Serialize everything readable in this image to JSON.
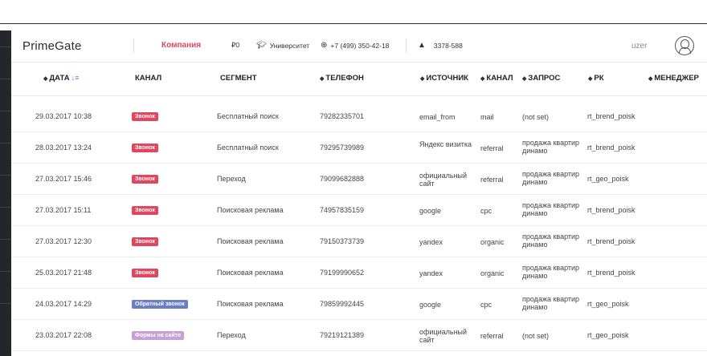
{
  "header": {
    "logo": "PrimeGate",
    "company": "Компания",
    "balance": "₽0",
    "university": "Университет",
    "phone": "+7 (499) 350-42-18",
    "account_id": "3378-588",
    "user": "uzer"
  },
  "columns": {
    "date": "ДАТА",
    "channel": "КАНАЛ",
    "segment": "СЕГМЕНТ",
    "phone": "ТЕЛЕФОН",
    "source": "ИСТОЧНИК",
    "medium": "КАНАЛ",
    "query": "ЗАПРОС",
    "campaign": "РК",
    "manager": "МЕНЕДЖЕР"
  },
  "colors": {
    "badge_call": "#e0465e",
    "badge_callback": "#6b7ec2",
    "badge_form": "#c9a0d6",
    "company": "#e0465e"
  },
  "rows": [
    {
      "date": "29.03.2017 10:38",
      "badge": "Звонок",
      "badge_type": "call",
      "segment": "Бесплатный поиск",
      "phone": "79282335701",
      "source": "email_from",
      "medium": "mail",
      "query": "(not set)",
      "campaign": "rt_brend_poisk"
    },
    {
      "date": "28.03.2017 13:24",
      "badge": "Звонок",
      "badge_type": "call",
      "segment": "Бесплатный поиск",
      "phone": "79295739989",
      "source": "Яндекс визитка",
      "medium": "referral",
      "query": "продажа квартир динамо",
      "campaign": "rt_brend_poisk"
    },
    {
      "date": "27.03.2017 15:46",
      "badge": "Звонок",
      "badge_type": "call",
      "segment": "Переход",
      "phone": "79099682888",
      "source": "официальный сайт",
      "medium": "referral",
      "query": "продажа квартир динамо",
      "campaign": "rt_geo_poisk"
    },
    {
      "date": "27.03.2017 15:11",
      "badge": "Звонок",
      "badge_type": "call",
      "segment": "Поисковая реклама",
      "phone": "74957835159",
      "source": "google",
      "medium": "cpc",
      "query": "продажа квартир динамо",
      "campaign": "rt_brend_poisk"
    },
    {
      "date": "27.03.2017 12:30",
      "badge": "Звонок",
      "badge_type": "call",
      "segment": "Поисковая реклама",
      "phone": "79150373739",
      "source": "yandex",
      "medium": "organic",
      "query": "продажа квартир динамо",
      "campaign": "rt_brend_poisk"
    },
    {
      "date": "25.03.2017 21:48",
      "badge": "Звонок",
      "badge_type": "call",
      "segment": "Поисковая реклама",
      "phone": "79199990652",
      "source": "yandex",
      "medium": "organic",
      "query": "продажа квартир динамо",
      "campaign": "rt_brend_poisk"
    },
    {
      "date": "24.03.2017 14:29",
      "badge": "Обратный звонок",
      "badge_type": "callback",
      "segment": "Поисковая реклама",
      "phone": "79859992445",
      "source": "google",
      "medium": "cpc",
      "query": "продажа квартир динамо",
      "campaign": "rt_geo_poisk"
    },
    {
      "date": "23.03.2017 22:08",
      "badge": "Формы на сайте",
      "badge_type": "form",
      "segment": "Переход",
      "phone": "79219121389",
      "source": "официальный сайт",
      "medium": "referral",
      "query": "(not set)",
      "campaign": "rt_geo_poisk"
    }
  ]
}
